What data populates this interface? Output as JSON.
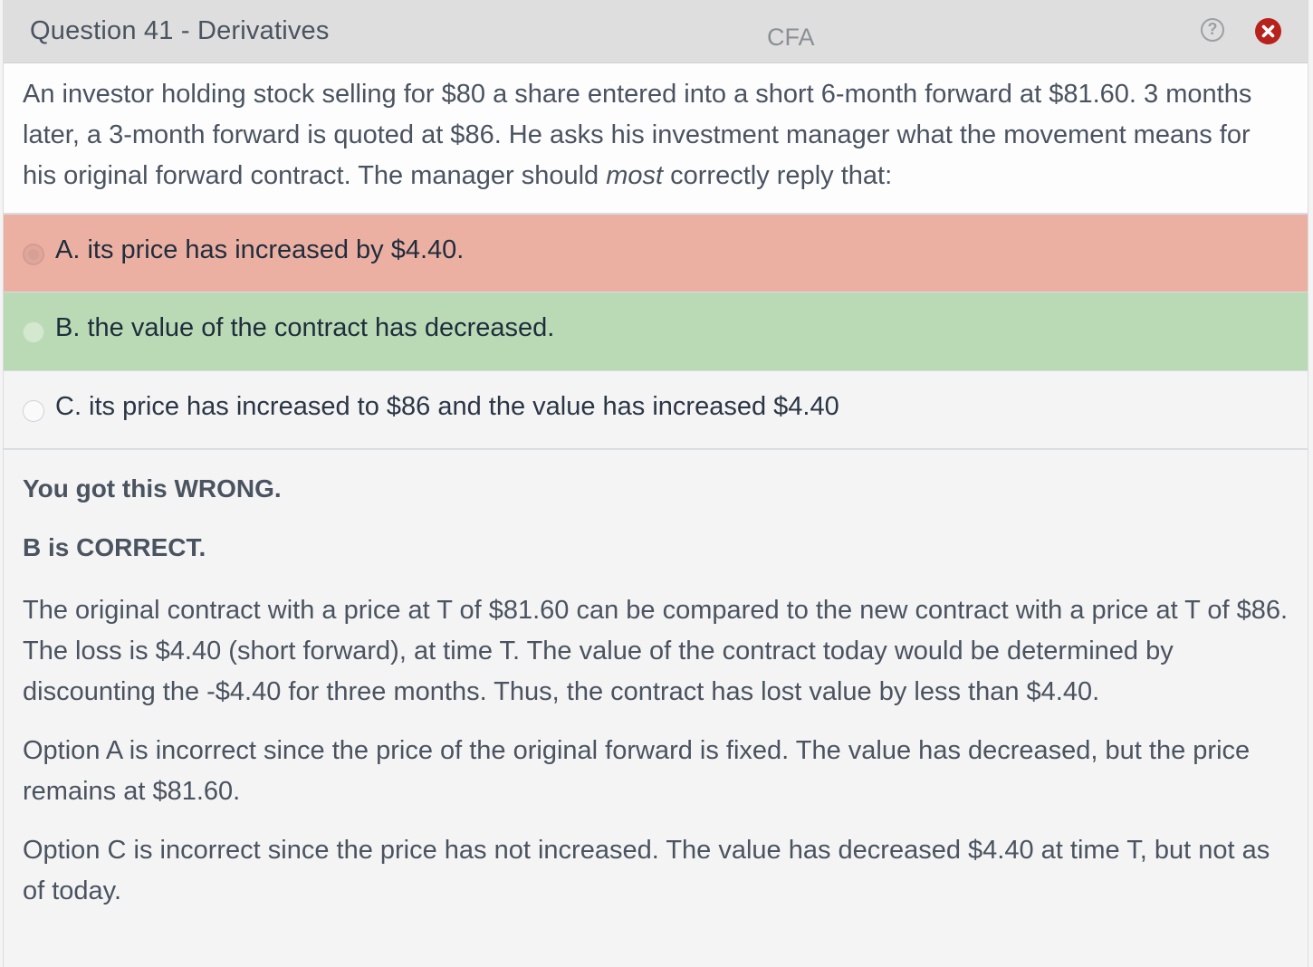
{
  "header": {
    "title": "Question 41 - Derivatives",
    "brand": "CFA",
    "help_icon": "?",
    "close_icon": "close-icon"
  },
  "question": {
    "text_before": "An investor holding stock selling for $80 a share entered into a short 6-month forward at $81.60. 3 months later, a 3-month forward is quoted at $86.  He asks his investment manager what the movement means for his original forward contract. The manager should ",
    "emphasis": "most",
    "text_after": " correctly reply that:"
  },
  "options": [
    {
      "label": "A. its price has increased by $4.40.",
      "state": "wrong",
      "color": "#ecb0a3"
    },
    {
      "label": "B. the value of the contract has decreased.",
      "state": "correct",
      "color": "#b9dab4"
    },
    {
      "label": "C. its price has increased to $86 and the value has increased $4.40",
      "state": "neutral",
      "color": "#f4f4f4"
    }
  ],
  "explanation": {
    "result": "You got this WRONG.",
    "correct": "B is CORRECT.",
    "paragraphs": [
      "The original contract with a price at T of $81.60 can be compared to the new contract with a price at T of $86.  The loss is $4.40 (short forward), at time T.  The value of the contract today would be determined by discounting the -$4.40 for three months.  Thus, the contract has lost value by less than $4.40.",
      "Option A is incorrect since the price of the original forward is fixed.  The value has decreased, but the price remains at $81.60.",
      "Option C is incorrect since the price has not increased.  The value has decreased $4.40 at time T, but not as of today."
    ]
  },
  "colors": {
    "close_button": "#b8221d",
    "wrong_bg": "#ecb0a3",
    "correct_bg": "#b9dab4"
  }
}
